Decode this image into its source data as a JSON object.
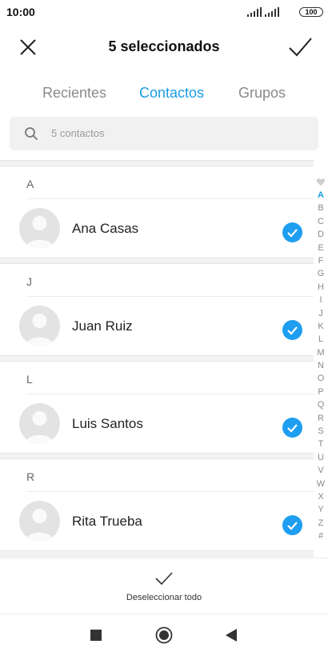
{
  "status_bar": {
    "time": "10:00",
    "battery": "100"
  },
  "header": {
    "title": "5 seleccionados"
  },
  "tabs": [
    {
      "label": "Recientes",
      "active": false
    },
    {
      "label": "Contactos",
      "active": true
    },
    {
      "label": "Grupos",
      "active": false
    }
  ],
  "search": {
    "placeholder": "5 contactos"
  },
  "sections": [
    {
      "letter": "A",
      "contact": "Ana Casas",
      "selected": true
    },
    {
      "letter": "J",
      "contact": "Juan Ruiz",
      "selected": true
    },
    {
      "letter": "L",
      "contact": "Luis Santos",
      "selected": true
    },
    {
      "letter": "R",
      "contact": "Rita Trueba",
      "selected": true
    }
  ],
  "alpha_index": {
    "letters": [
      "A",
      "B",
      "C",
      "D",
      "E",
      "F",
      "G",
      "H",
      "I",
      "J",
      "K",
      "L",
      "M",
      "N",
      "O",
      "P",
      "Q",
      "R",
      "S",
      "T",
      "U",
      "V",
      "W",
      "X",
      "Y",
      "Z",
      "#"
    ],
    "active": "A"
  },
  "bottom_bar": {
    "deselect_label": "Deseleccionar todo"
  },
  "colors": {
    "accent": "#1a9de2",
    "check": "#1e9ef0"
  }
}
